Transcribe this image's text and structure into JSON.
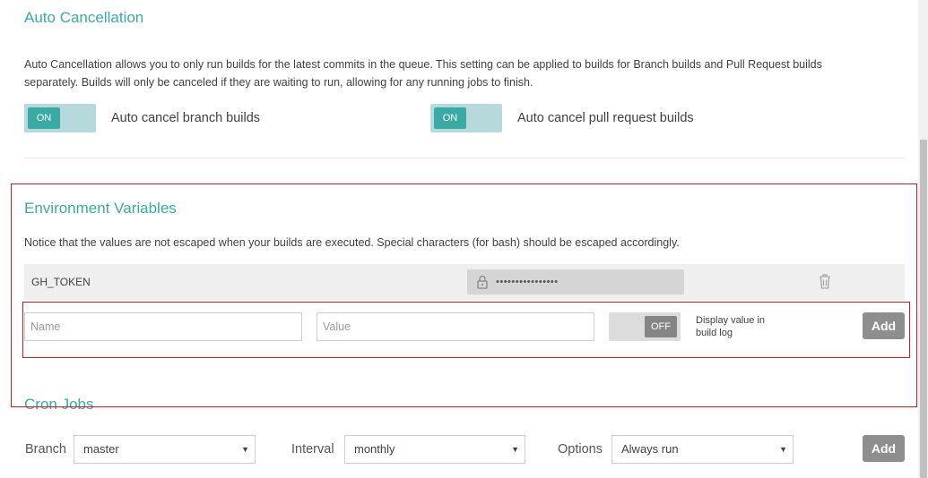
{
  "auto_cancellation": {
    "title": "Auto Cancellation",
    "description_line1": "Auto Cancellation allows you to only run builds for the latest commits in the queue. This setting can be applied to builds for Branch builds and Pull Request builds",
    "description_line2": "separately. Builds will only be canceled if they are waiting to run, allowing for any running jobs to finish.",
    "branch_toggle": {
      "state": "ON",
      "label": "Auto cancel branch builds"
    },
    "pr_toggle": {
      "state": "ON",
      "label": "Auto cancel pull request builds"
    }
  },
  "env_vars": {
    "title": "Environment Variables",
    "notice": "Notice that the values are not escaped when your builds are executed. Special characters (for bash) should be escaped accordingly.",
    "existing": [
      {
        "name": "GH_TOKEN",
        "value_masked": "••••••••••••••••"
      }
    ],
    "new": {
      "name_placeholder": "Name",
      "value_placeholder": "Value",
      "display_toggle": "OFF",
      "display_label_line1": "Display value in",
      "display_label_line2": "build log",
      "add_label": "Add"
    }
  },
  "cron": {
    "title": "Cron Jobs",
    "branch_label": "Branch",
    "branch_value": "master",
    "interval_label": "Interval",
    "interval_value": "monthly",
    "options_label": "Options",
    "options_value": "Always run",
    "add_label": "Add"
  },
  "colors": {
    "accent": "#39aaa4",
    "toggle_bg": "#b6d9dc",
    "annotation_red": "#d7191c",
    "button_gray": "#8e8e8e"
  }
}
